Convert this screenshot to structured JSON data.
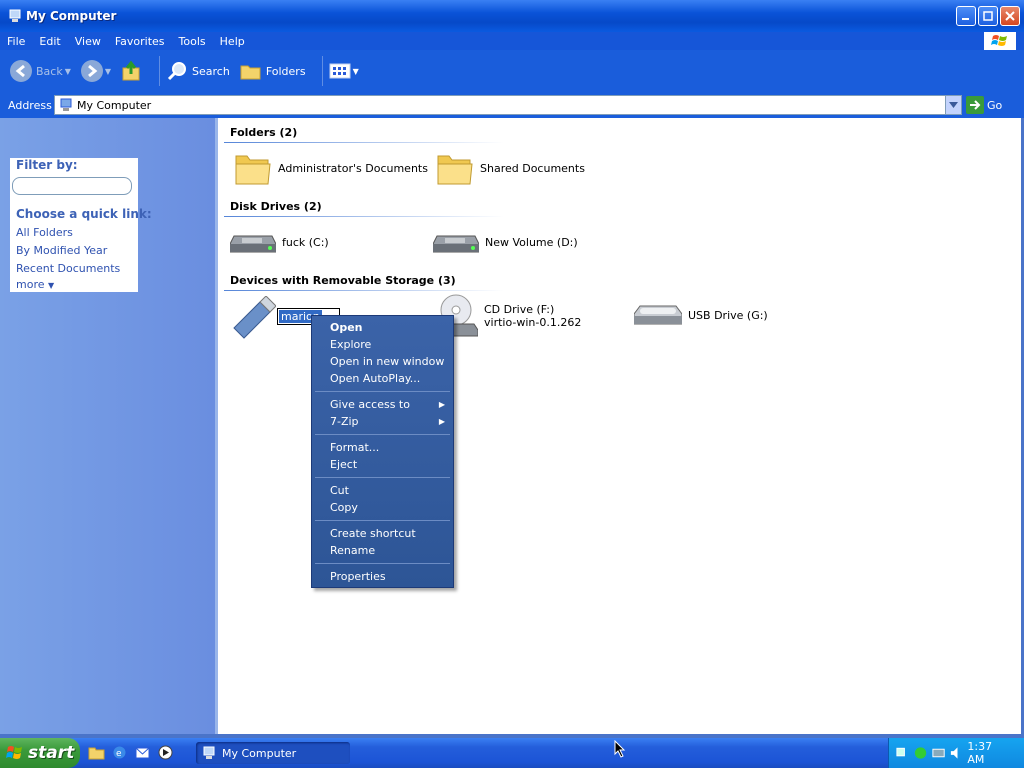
{
  "window": {
    "title": "My Computer",
    "icon": "computer-icon"
  },
  "menubar": {
    "items": [
      "File",
      "Edit",
      "View",
      "Favorites",
      "Tools",
      "Help"
    ]
  },
  "toolbar": {
    "back_label": "Back",
    "search_label": "Search",
    "folders_label": "Folders"
  },
  "address": {
    "label": "Address",
    "value": "My Computer",
    "go_label": "Go"
  },
  "leftpane": {
    "filter_title": "Filter by:",
    "quicklink_title": "Choose a quick link:",
    "links": [
      "All Folders",
      "By Modified Year",
      "Recent Documents",
      "more"
    ]
  },
  "groups": {
    "folders": {
      "header": "Folders (2)",
      "items": [
        "Administrator's Documents",
        "Shared Documents"
      ]
    },
    "disks": {
      "header": "Disk Drives (2)",
      "items": [
        "fuck (C:)",
        "New Volume (D:)"
      ]
    },
    "removable": {
      "header": "Devices with Removable Storage (3)",
      "rename_text": "marion",
      "cd_label": "CD Drive (F:)",
      "cd_sub": "virtio-win-0.1.262",
      "usb_label": "USB Drive (G:)"
    }
  },
  "context_menu": {
    "group1": [
      "Open",
      "Explore",
      "Open in new window",
      "Open AutoPlay..."
    ],
    "group2": [
      "Give access to",
      "7-Zip"
    ],
    "group3": [
      "Format...",
      "Eject"
    ],
    "group4": [
      "Cut",
      "Copy"
    ],
    "group5": [
      "Create shortcut",
      "Rename"
    ],
    "group6": [
      "Properties"
    ]
  },
  "taskbar": {
    "start_label": "start",
    "task_label": "My Computer",
    "clock": "1:37 AM"
  },
  "colors": {
    "title_blue": "#0a53d8",
    "menu_blue": "#1656d8",
    "start_green": "#3a9a3a",
    "context_blue": "#3b63a8",
    "link_blue": "#2f52b0"
  }
}
